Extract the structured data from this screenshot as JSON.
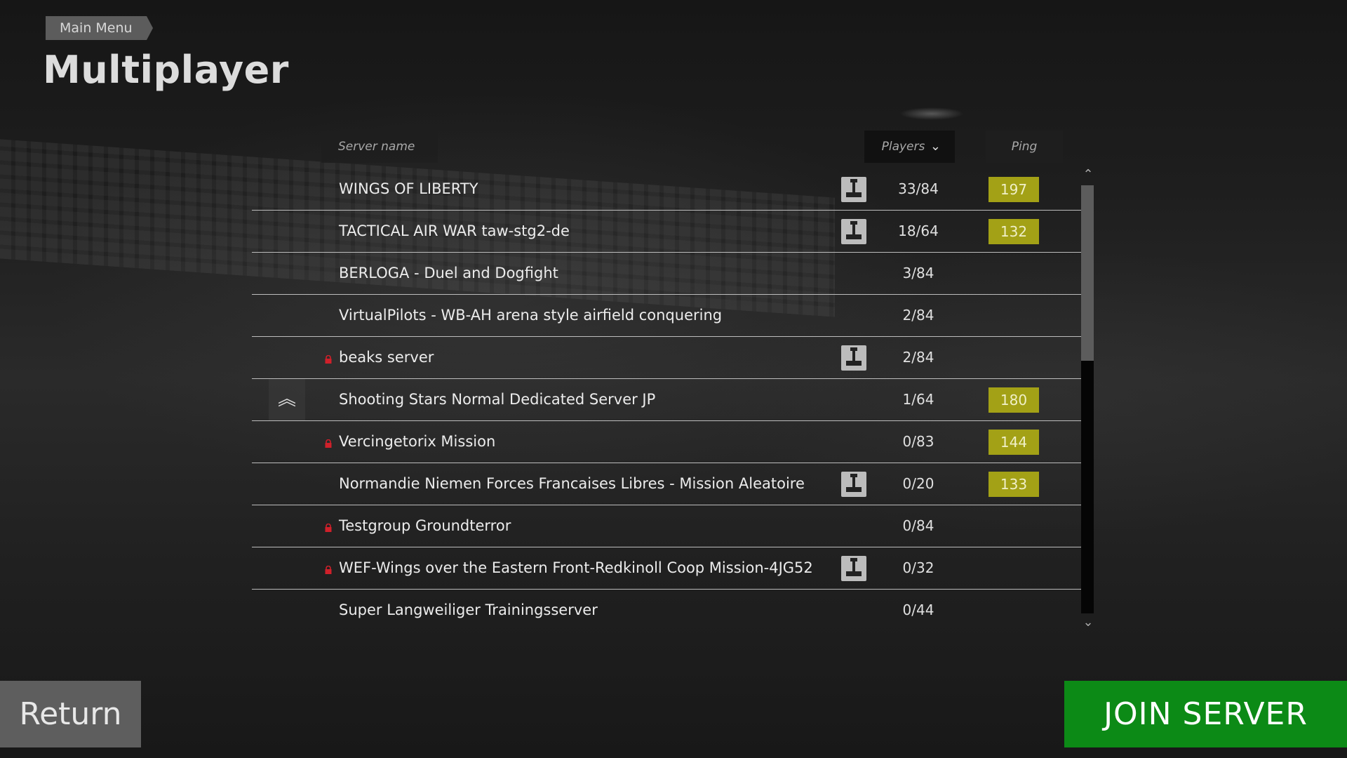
{
  "breadcrumb": "Main Menu",
  "title": "Multiplayer",
  "columns": {
    "server_name": "Server name",
    "players": "Players",
    "ping": "Ping"
  },
  "colors": {
    "ping_badge": "#a3a116",
    "join_button": "#0c8a16",
    "lock_icon": "#d0202a"
  },
  "servers": [
    {
      "name": "WINGS OF LIBERTY",
      "players": "33/84",
      "ping": "197",
      "locked": false,
      "joystick_icon": true,
      "promoted": false
    },
    {
      "name": "TACTICAL AIR WAR taw-stg2-de",
      "players": "18/64",
      "ping": "132",
      "locked": false,
      "joystick_icon": true,
      "promoted": false
    },
    {
      "name": "BERLOGA - Duel and Dogfight",
      "players": "3/84",
      "ping": "",
      "locked": false,
      "joystick_icon": false,
      "promoted": false
    },
    {
      "name": "VirtualPilots - WB-AH arena style airfield conquering",
      "players": "2/84",
      "ping": "",
      "locked": false,
      "joystick_icon": false,
      "promoted": false
    },
    {
      "name": "beaks server",
      "players": "2/84",
      "ping": "",
      "locked": true,
      "joystick_icon": true,
      "promoted": false
    },
    {
      "name": "Shooting Stars Normal Dedicated Server JP",
      "players": "1/64",
      "ping": "180",
      "locked": false,
      "joystick_icon": false,
      "promoted": true
    },
    {
      "name": "Vercingetorix Mission",
      "players": "0/83",
      "ping": "144",
      "locked": true,
      "joystick_icon": false,
      "promoted": false
    },
    {
      "name": "Normandie Niemen Forces Francaises Libres - Mission Aleatoire",
      "players": "0/20",
      "ping": "133",
      "locked": false,
      "joystick_icon": true,
      "promoted": false
    },
    {
      "name": "Testgroup Groundterror",
      "players": "0/84",
      "ping": "",
      "locked": true,
      "joystick_icon": false,
      "promoted": false
    },
    {
      "name": "WEF-Wings over the Eastern Front-Redkinoll Coop Mission-4JG52",
      "players": "0/32",
      "ping": "",
      "locked": true,
      "joystick_icon": true,
      "promoted": false
    },
    {
      "name": "Super Langweiliger Trainingsserver",
      "players": "0/44",
      "ping": "",
      "locked": false,
      "joystick_icon": false,
      "promoted": false
    }
  ],
  "buttons": {
    "return": "Return",
    "join": "JOIN SERVER"
  },
  "icons": {
    "sort": "chevron-down-icon",
    "scroll_up": "chevron-up-icon",
    "scroll_down": "chevron-down-icon",
    "promoted": "double-chevron-up-icon",
    "joystick": "joystick-icon",
    "lock": "lock-icon"
  }
}
